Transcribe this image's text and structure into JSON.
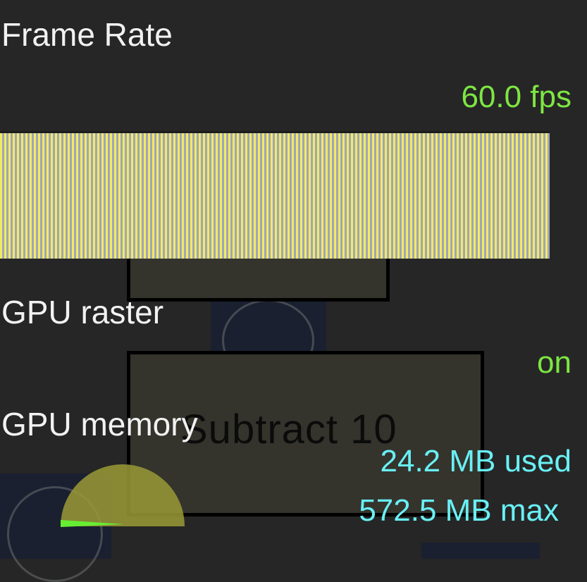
{
  "hud": {
    "frame_rate": {
      "title": "Frame Rate",
      "value": "60.0 fps"
    },
    "gpu_raster": {
      "title": "GPU raster",
      "value": "on"
    },
    "gpu_memory": {
      "title": "GPU memory",
      "used": "24.2 MB used",
      "max": "572.5 MB max"
    },
    "gauge_fraction": 0.042
  },
  "background": {
    "button_text": "Subtract 10"
  },
  "colors": {
    "value_green": "#7de642",
    "memory_cyan": "#69f0f5",
    "bar_yellow": "#f3ea64",
    "bar_gray": "#9fa6b8",
    "gauge_fill": "#9b9a36"
  }
}
